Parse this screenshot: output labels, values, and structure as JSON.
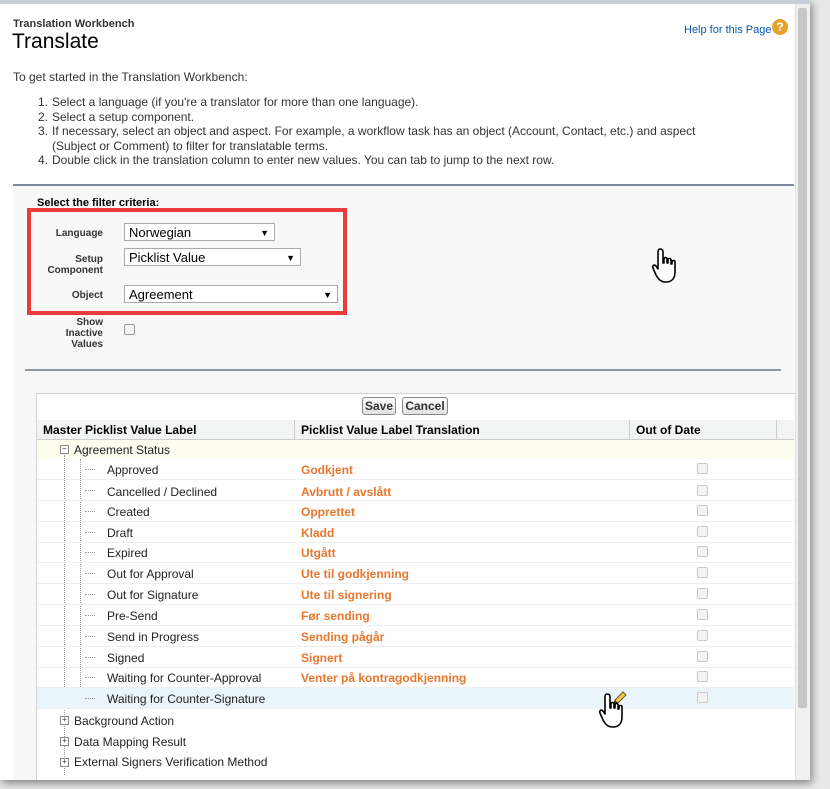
{
  "header": {
    "breadcrumb": "Translation Workbench",
    "title": "Translate",
    "help_link": "Help for this Page",
    "help_icon": "?"
  },
  "intro": "To get started in the Translation Workbench:",
  "steps": [
    {
      "num": "1.",
      "text": "Select a language (if you're a translator for more than one language)."
    },
    {
      "num": "2.",
      "text": "Select a setup component."
    },
    {
      "num": "3.",
      "text": "If necessary, select an object and aspect. For example, a workflow task has an object (Account, Contact, etc.) and aspect"
    },
    {
      "num": "",
      "text": "(Subject or Comment) to filter for translatable terms."
    },
    {
      "num": "4.",
      "text": "Double click in the translation column to enter new values. You can tab to jump to the next row."
    }
  ],
  "filter": {
    "title": "Select the filter criteria:",
    "language_label": "Language",
    "language_value": "Norwegian",
    "setup_label_1": "Setup",
    "setup_label_2": "Component",
    "setup_value": "Picklist Value",
    "object_label": "Object",
    "object_value": "Agreement",
    "inactive_label_1": "Show",
    "inactive_label_2": "Inactive",
    "inactive_label_3": "Values",
    "dropdown_arrow": "▼"
  },
  "grid": {
    "save_label": "Save",
    "cancel_label": "Cancel",
    "columns": [
      "Master Picklist Value Label",
      "Picklist Value Label Translation",
      "Out of Date"
    ],
    "expanded_group": "Agreement Status",
    "rows": [
      {
        "master": "Approved",
        "translation": "Godkjent"
      },
      {
        "master": "Cancelled / Declined",
        "translation": "Avbrutt / avslått"
      },
      {
        "master": "Created",
        "translation": "Opprettet"
      },
      {
        "master": "Draft",
        "translation": "Kladd"
      },
      {
        "master": "Expired",
        "translation": "Utgått"
      },
      {
        "master": "Out for Approval",
        "translation": "Ute til godkjenning"
      },
      {
        "master": "Out for Signature",
        "translation": "Ute til signering"
      },
      {
        "master": "Pre-Send",
        "translation": "Før sending"
      },
      {
        "master": "Send in Progress",
        "translation": "Sending pågår"
      },
      {
        "master": "Signed",
        "translation": "Signert"
      },
      {
        "master": "Waiting for Counter-Approval",
        "translation": "Venter på kontragodkjenning"
      },
      {
        "master": "Waiting for Counter-Signature",
        "translation": ""
      }
    ],
    "collapsed_groups": [
      "Background Action",
      "Data Mapping Result",
      "External Signers Verification Method"
    ],
    "minus_sign": "−",
    "plus_sign": "+"
  },
  "colors": {
    "translation_text": "#e8772e",
    "highlight_border": "#ea3b3b",
    "link": "#015ba7"
  }
}
